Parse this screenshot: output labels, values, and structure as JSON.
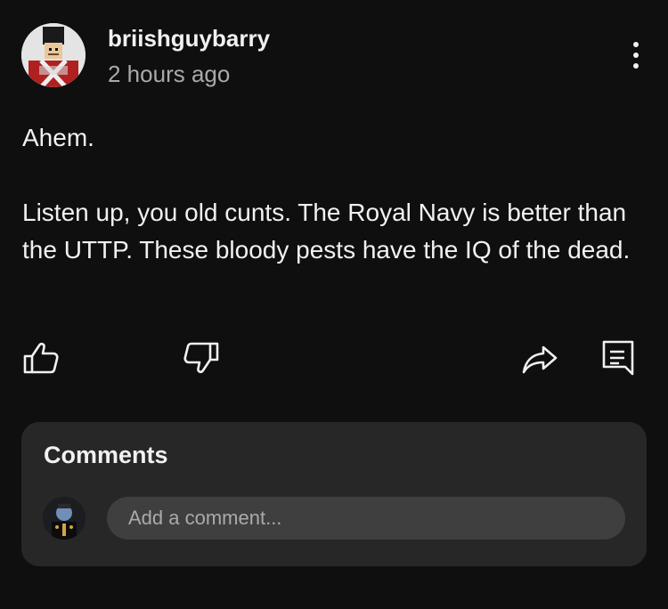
{
  "post": {
    "username": "briishguybarry",
    "timestamp": "2 hours ago",
    "paragraphs": [
      "Ahem.",
      "Listen up, you old cunts. The Royal Navy is better than the UTTP. These bloody pests have the IQ of the dead."
    ]
  },
  "icons": {
    "more": "more-vertical-icon",
    "like": "thumbs-up-icon",
    "dislike": "thumbs-down-icon",
    "share": "share-icon",
    "comment": "comment-icon"
  },
  "comments": {
    "title": "Comments",
    "placeholder": "Add a comment..."
  },
  "colors": {
    "background": "#0f0f0f",
    "panel": "#272727",
    "input": "#3f3f3f",
    "text_primary": "#f1f1f1",
    "text_secondary": "#aaaaaa"
  }
}
